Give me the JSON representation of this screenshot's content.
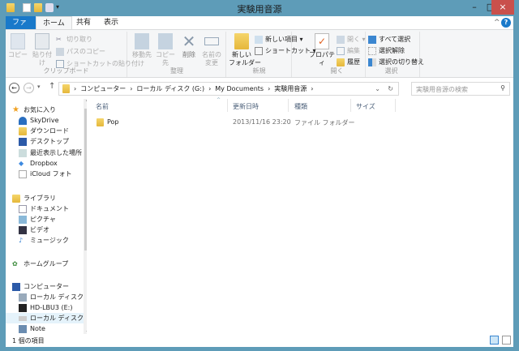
{
  "window": {
    "title": "実験用音源",
    "minimize": "–",
    "maximize": "□",
    "close": "×"
  },
  "tabs": [
    {
      "label": "ファイル"
    },
    {
      "label": "ホーム"
    },
    {
      "label": "共有"
    },
    {
      "label": "表示"
    }
  ],
  "help": "?",
  "ribbon": {
    "clipboard": {
      "label": "クリップボード",
      "copy": "コピー",
      "paste": "貼り付け",
      "cut": "切り取り",
      "copy_path": "パスのコピー",
      "paste_shortcut": "ショートカットの貼り付け"
    },
    "organize": {
      "label": "整理",
      "move_to": "移動先",
      "copy_to": "コピー先",
      "delete": "削除",
      "rename": "名前の\n変更"
    },
    "new": {
      "label": "新規",
      "new_folder": "新しい\nフォルダー",
      "new_item": "新しい項目 ▾",
      "shortcut": "ショートカット ▾"
    },
    "open": {
      "label": "開く",
      "properties": "プロパティ",
      "open": "開く ▾",
      "edit": "編集",
      "history": "履歴"
    },
    "select": {
      "label": "選択",
      "select_all": "すべて選択",
      "select_none": "選択解除",
      "invert": "選択の切り替え"
    }
  },
  "address": {
    "crumbs": [
      "コンピューター",
      "ローカル ディスク (G:)",
      "My Documents",
      "実験用音源"
    ],
    "search_placeholder": "実験用音源の検索"
  },
  "nav": {
    "favorites": "お気に入り",
    "fav_items": [
      "SkyDrive",
      "ダウンロード",
      "デスクトップ",
      "最近表示した場所",
      "Dropbox",
      "iCloud フォト"
    ],
    "libraries": "ライブラリ",
    "lib_items": [
      "ドキュメント",
      "ピクチャ",
      "ビデオ",
      "ミュージック"
    ],
    "homegroup": "ホームグループ",
    "computer": "コンピューター",
    "comp_items": [
      "ローカル ディスク (C:)",
      "HD-LBU3 (E:)",
      "ローカル ディスク (G:)",
      "Note"
    ]
  },
  "columns": {
    "name": "名前",
    "modified": "更新日時",
    "type": "種類",
    "size": "サイズ"
  },
  "files": [
    {
      "name": "Pop",
      "modified": "2013/11/16 23:20",
      "type": "ファイル フォルダー",
      "size": ""
    }
  ],
  "status": {
    "count": "1 個の項目"
  }
}
